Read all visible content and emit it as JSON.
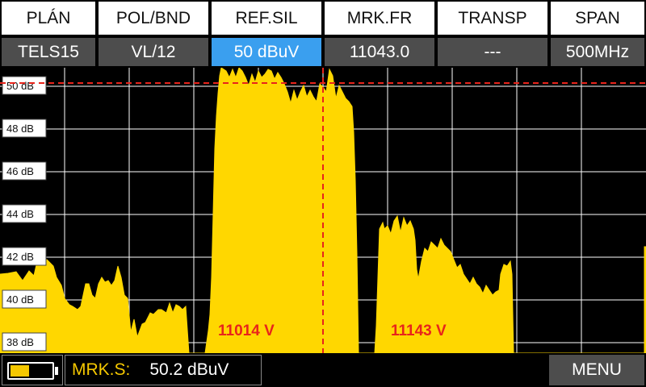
{
  "header": {
    "labels": [
      "PLÁN",
      "POL/BND",
      "REF.SIL",
      "MRK.FR",
      "TRANSP",
      "SPAN"
    ],
    "values": [
      "TELS15",
      "VL/12",
      "50 dBuV",
      "11043.0",
      "---",
      "500MHz"
    ],
    "active_index": 2
  },
  "spectrum": {
    "y_ticks": [
      "50 dB",
      "48 dB",
      "46 dB",
      "44 dB",
      "42 dB",
      "40 dB",
      "38 dB"
    ],
    "ref_level_db": 50,
    "marker_freq": "11043.0",
    "markers": [
      {
        "label": "11014 V"
      },
      {
        "label": "11143 V"
      }
    ],
    "colors": {
      "trace": "#ffd700",
      "grid": "#ffffff",
      "marker": "#e8241b",
      "background": "#000000"
    }
  },
  "footer": {
    "battery_level": 0.45,
    "mrk_label": "MRK.S:",
    "mrk_value": "50.2 dBuV",
    "menu_label": "MENU"
  }
}
